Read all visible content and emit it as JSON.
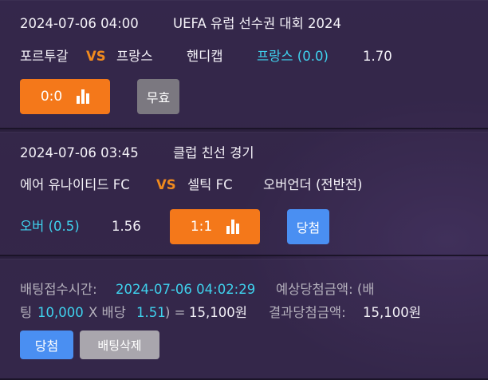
{
  "bet1": {
    "datetime": "2024-07-06 04:00",
    "league": "UEFA 유럽 선수권 대회 2024",
    "home": "포르투갈",
    "vs": "VS",
    "away": "프랑스",
    "market": "핸디캡",
    "pick": "프랑스 (0.0)",
    "odds": "1.70",
    "score": "0:0",
    "status": "무효"
  },
  "bet2": {
    "datetime": "2024-07-06 03:45",
    "league": "클럽 친선 경기",
    "home": "에어 유나이티드 FC",
    "vs": "VS",
    "away": "셀틱 FC",
    "market": "오버언더 (전반전)",
    "pick": "오버 (0.5)",
    "odds": "1.56",
    "score": "1:1",
    "status": "당첨"
  },
  "summary": {
    "time_label": "배팅접수시간:",
    "time_value": "2024-07-06 04:02:29",
    "expected_label": "예상당첨금액: (배",
    "line2_prefix": "팅",
    "stake": "10,000",
    "times": "X 배당",
    "total_odds": "1.51",
    "equals": ") =",
    "expected_amount": "15,100원",
    "result_label": "결과당첨금액:",
    "result_amount": "15,100원",
    "status_button": "당첨",
    "delete_button": "배팅삭제"
  },
  "colors": {
    "accent_orange": "#f4781a",
    "accent_cyan": "#3fd2ee",
    "win_blue": "#4a8ff2",
    "void_gray": "#7b7880",
    "background": "#2a1f3d"
  },
  "icons": {
    "score_stats": "bar-chart-icon"
  }
}
